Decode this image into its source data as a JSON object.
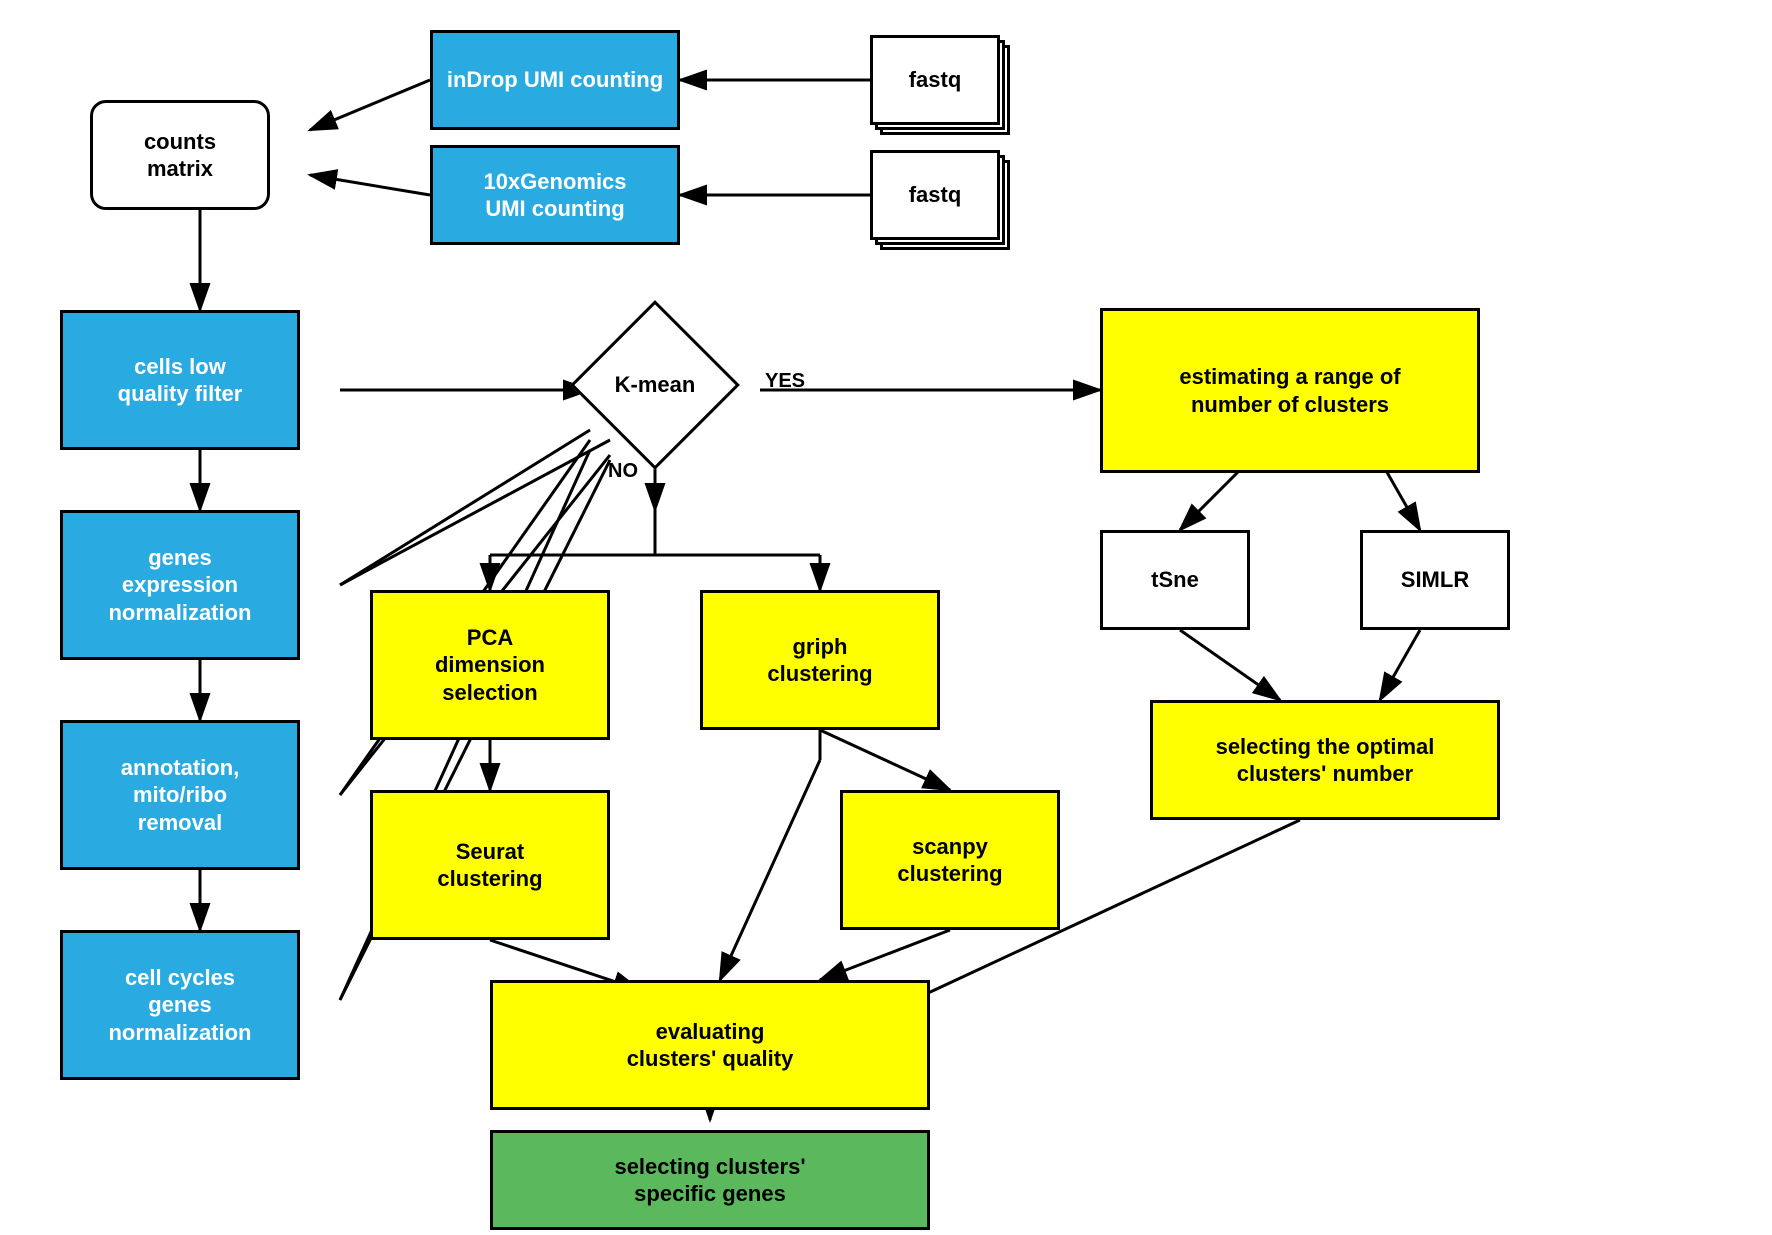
{
  "nodes": {
    "indrop": {
      "label": "inDrop\nUMI counting"
    },
    "genomics": {
      "label": "10xGenomics\nUMI counting"
    },
    "counts_matrix": {
      "label": "counts\nmatrix"
    },
    "fastq1": {
      "label": "fastq"
    },
    "fastq2": {
      "label": "fastq"
    },
    "cells_filter": {
      "label": "cells low\nquality filter"
    },
    "genes_norm": {
      "label": "genes\nexpression\nnormalization"
    },
    "annotation": {
      "label": "annotation,\nmito/ribo\nremoval"
    },
    "cell_cycles": {
      "label": "cell cycles\ngenes\nnormalization"
    },
    "kmean": {
      "label": "K-mean"
    },
    "kmean_yes": {
      "label": "YES"
    },
    "kmean_no": {
      "label": "NO"
    },
    "estimating": {
      "label": "estimating a range of\nnumber of clusters"
    },
    "tsne": {
      "label": "tSne"
    },
    "simlr": {
      "label": "SIMLR"
    },
    "optimal_clusters": {
      "label": "selecting the optimal\nclusters' number"
    },
    "pca": {
      "label": "PCA\ndimension\nselection"
    },
    "seurat": {
      "label": "Seurat\nclustering"
    },
    "griph": {
      "label": "griph\nclustering"
    },
    "scanpy": {
      "label": "scanpy\nclustering"
    },
    "evaluating": {
      "label": "evaluating\nclusters' quality"
    },
    "selecting_genes": {
      "label": "selecting clusters'\nspecific genes"
    }
  }
}
